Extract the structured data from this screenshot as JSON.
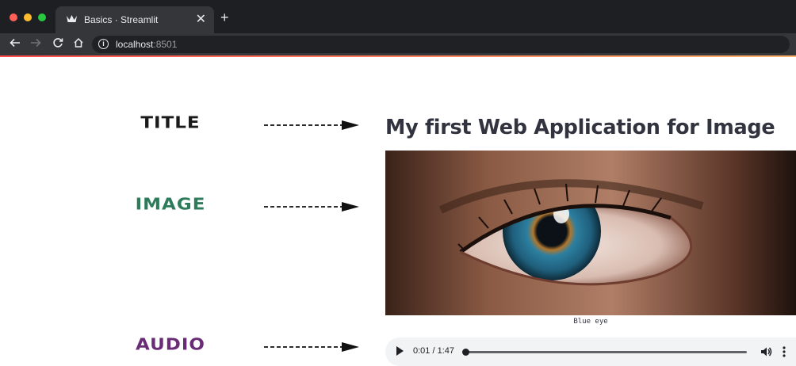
{
  "browser": {
    "tab_title": "Basics · Streamlit",
    "tab_icon": "streamlit-crown-icon",
    "close_glyph": "✕",
    "new_tab_glyph": "+",
    "url_host": "localhost",
    "url_port": ":8501",
    "info_glyph": "i"
  },
  "annotations": {
    "title_label": "TITLE",
    "image_label": "IMAGE",
    "audio_label": "AUDIO"
  },
  "app": {
    "title": "My first Web Application for Image",
    "image_caption": "Blue eye",
    "audio": {
      "time_display": "0:01 / 1:47",
      "progress_fraction": 0.009
    }
  },
  "colors": {
    "title_label": "#1a1a1a",
    "image_label": "#2e7b5c",
    "audio_label": "#6a2c76",
    "accent_start": "#ff4b4b",
    "accent_end": "#fdb36c"
  }
}
